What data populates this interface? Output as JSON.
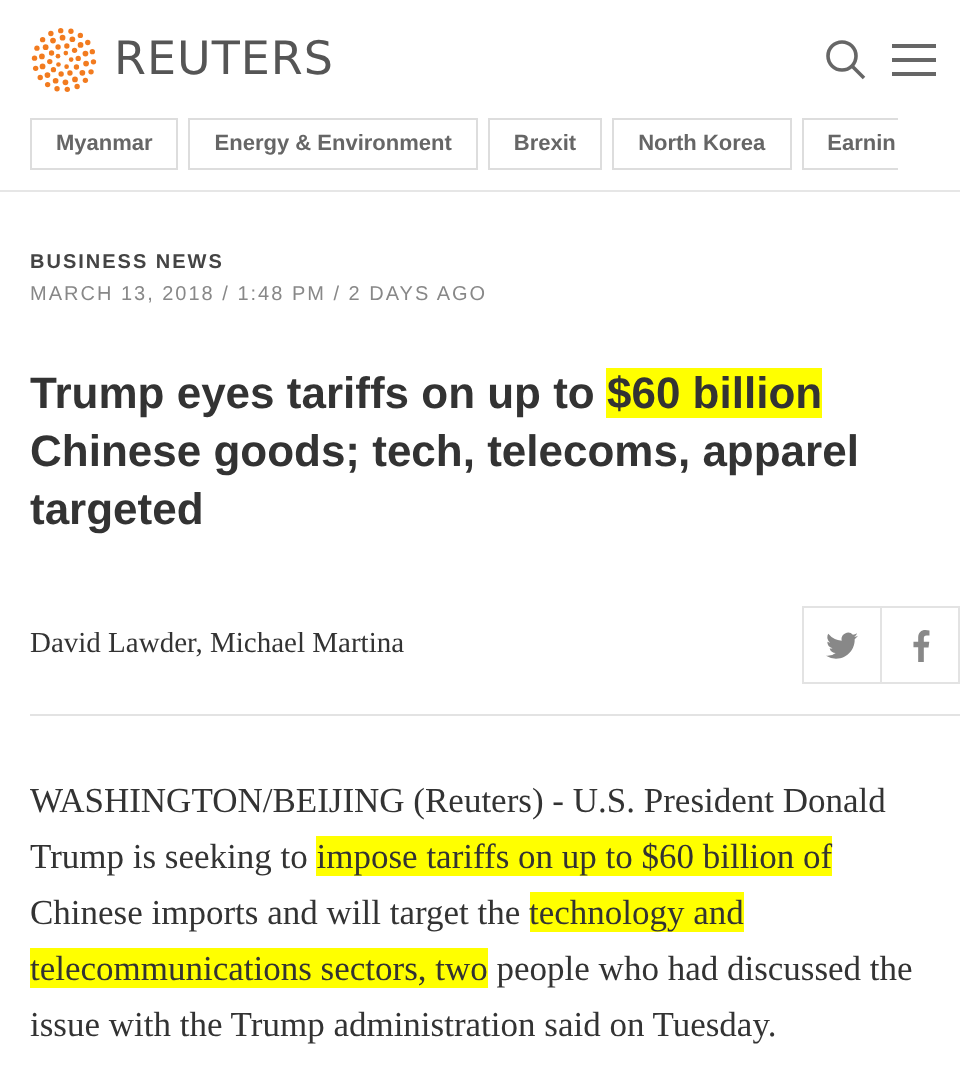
{
  "header": {
    "brand": "REUTERS"
  },
  "topics": [
    {
      "label": "Myanmar"
    },
    {
      "label": "Energy & Environment"
    },
    {
      "label": "Brexit"
    },
    {
      "label": "North Korea"
    },
    {
      "label": "Earnin"
    }
  ],
  "article": {
    "section": "BUSINESS NEWS",
    "dateline": "MARCH 13, 2018 / 1:48 PM / 2 DAYS AGO",
    "headline": [
      {
        "text": "Trump eyes tariffs on up to ",
        "highlighted": false
      },
      {
        "text": "$60 billion",
        "highlighted": true
      },
      {
        "text": " Chinese goods; tech, telecoms, apparel targeted",
        "highlighted": false
      }
    ],
    "byline": "David Lawder, Michael Martina",
    "body": [
      {
        "text": "WASHINGTON/BEIJING (Reuters) - U.S. President Donald Trump is seeking to ",
        "highlighted": false
      },
      {
        "text": "impose tariffs on up to $60 billion of",
        "highlighted": true
      },
      {
        "text": " Chinese imports and will target the ",
        "highlighted": false
      },
      {
        "text": "technology and telecommunications sectors, two",
        "highlighted": true
      },
      {
        "text": " people who had discussed the issue with the Trump administration said on Tuesday.",
        "highlighted": false
      }
    ]
  }
}
